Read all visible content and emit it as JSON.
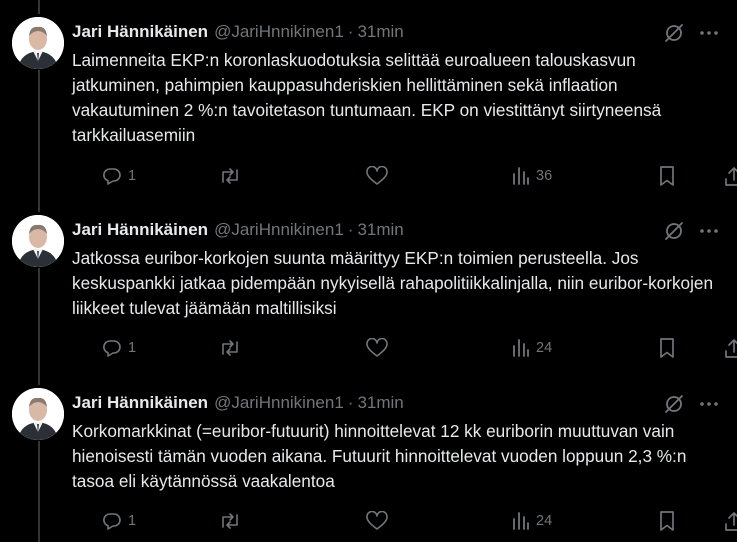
{
  "colors": {
    "background": "#000000",
    "text": "#e7e9ea",
    "muted": "#71767b",
    "thread_line": "#333639"
  },
  "tweets": [
    {
      "author": "Jari Hännikäinen",
      "handle": "@JariHnnikinen1",
      "separator": "·",
      "time": "31min",
      "text": "Laimenneita EKP:n koronlaskuodotuksia selittää euroalueen talouskasvun jatkuminen, pahimpien kauppasuhderiskien hellittäminen sekä inflaation vakautuminen 2 %:n tavoitetason tuntumaan. EKP on viestittänyt siirtyneensä tarkkailuasemiin",
      "replies": "1",
      "reposts": "",
      "likes": "",
      "views": "36",
      "icons": [
        "reply-icon",
        "repost-icon",
        "like-icon",
        "views-icon",
        "bookmark-icon",
        "share-icon",
        "grok-icon",
        "more-icon"
      ]
    },
    {
      "author": "Jari Hännikäinen",
      "handle": "@JariHnnikinen1",
      "separator": "·",
      "time": "31min",
      "text": "Jatkossa euribor-korkojen suunta määrittyy EKP:n toimien perusteella. Jos keskuspankki jatkaa pidempään nykyisellä rahapolitiikkalinjalla, niin euribor-korkojen liikkeet tulevat jäämään maltillisiksi",
      "replies": "1",
      "reposts": "",
      "likes": "",
      "views": "24"
    },
    {
      "author": "Jari Hännikäinen",
      "handle": "@JariHnnikinen1",
      "separator": "·",
      "time": "31min",
      "text": "Korkomarkkinat (=euribor-futuurit) hinnoittelevat 12 kk euriborin muuttuvan vain hienoisesti tämän vuoden aikana. Futuurit hinnoittelevat vuoden loppuun 2,3 %:n tasoa eli käytännössä vaakalentoa",
      "replies": "1",
      "reposts": "",
      "likes": "",
      "views": "24"
    }
  ]
}
